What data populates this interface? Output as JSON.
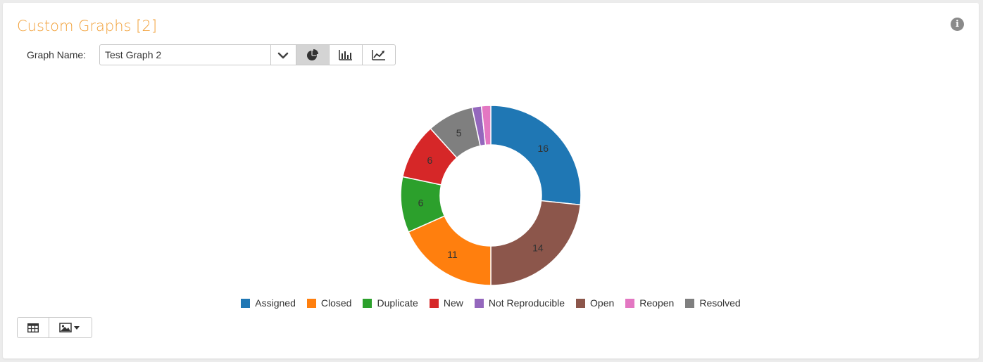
{
  "panel": {
    "title": "Custom Graphs [2]",
    "info_icon": "info-icon"
  },
  "graph_selector": {
    "label": "Graph Name:",
    "value": "Test Graph 2",
    "view_buttons": [
      {
        "icon": "pie-chart-icon",
        "active": true
      },
      {
        "icon": "bar-chart-icon",
        "active": false
      },
      {
        "icon": "line-chart-icon",
        "active": false
      }
    ]
  },
  "bottom_toolbar": {
    "buttons": [
      {
        "icon": "table-icon"
      },
      {
        "icon": "image-download-icon"
      }
    ]
  },
  "chart_data": {
    "type": "pie",
    "donut": true,
    "title": "",
    "legend_position": "bottom",
    "categories": [
      "Assigned",
      "Open",
      "Closed",
      "Duplicate",
      "New",
      "Resolved",
      "Not Reproducible",
      "Reopen"
    ],
    "values": [
      16,
      14,
      11,
      6,
      6,
      5,
      1,
      1
    ],
    "colors": [
      "#1f77b4",
      "#8c564b",
      "#ff7f0e",
      "#2ca02c",
      "#d62728",
      "#7f7f7f",
      "#9467bd",
      "#e377c2"
    ],
    "legend": [
      {
        "label": "Assigned",
        "color": "#1f77b4"
      },
      {
        "label": "Closed",
        "color": "#ff7f0e"
      },
      {
        "label": "Duplicate",
        "color": "#2ca02c"
      },
      {
        "label": "New",
        "color": "#d62728"
      },
      {
        "label": "Not Reproducible",
        "color": "#9467bd"
      },
      {
        "label": "Open",
        "color": "#8c564b"
      },
      {
        "label": "Reopen",
        "color": "#e377c2"
      },
      {
        "label": "Resolved",
        "color": "#7f7f7f"
      }
    ],
    "data_labels": [
      "16",
      "14",
      "11",
      "6",
      "6",
      "5",
      "",
      ""
    ]
  }
}
